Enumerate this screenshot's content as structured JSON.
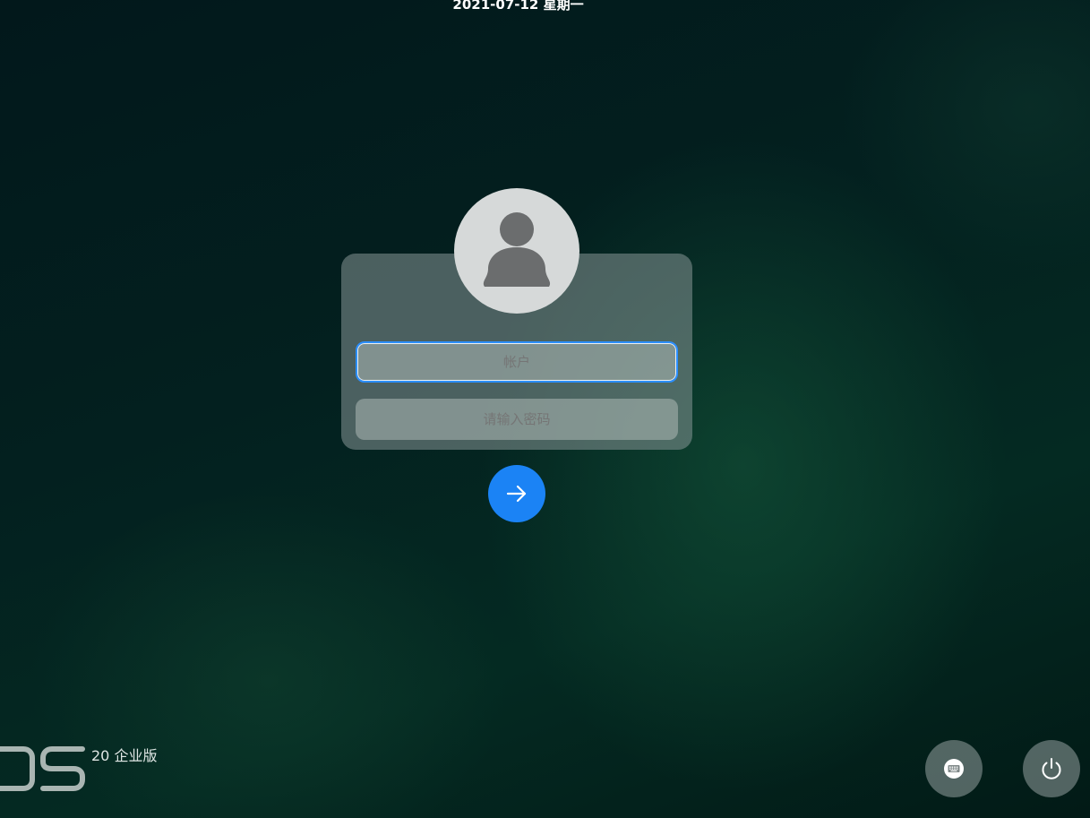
{
  "header": {
    "datetime": "2021-07-12 星期一"
  },
  "login": {
    "avatar_icon": "user-silhouette-icon",
    "account_placeholder": "帐户",
    "password_placeholder": "请输入密码",
    "submit_icon": "arrow-right-icon"
  },
  "brand": {
    "edition": "20 企业版"
  },
  "tray": {
    "keyboard_icon": "keyboard-icon",
    "power_icon": "power-icon"
  },
  "colors": {
    "accent": "#1b83f5",
    "background": "#02181b"
  }
}
